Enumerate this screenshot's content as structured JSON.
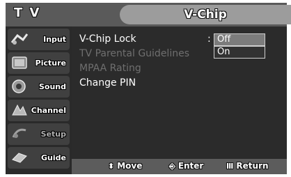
{
  "header": {
    "source_label": "T V",
    "title": "V-Chip"
  },
  "sidebar": {
    "items": [
      {
        "label": "Input",
        "icon": "input-icon"
      },
      {
        "label": "Picture",
        "icon": "picture-icon"
      },
      {
        "label": "Sound",
        "icon": "sound-icon"
      },
      {
        "label": "Channel",
        "icon": "channel-icon"
      },
      {
        "label": "Setup",
        "icon": "setup-icon"
      },
      {
        "label": "Guide",
        "icon": "guide-icon"
      }
    ]
  },
  "menu": {
    "items": [
      {
        "label": "V-Chip Lock",
        "enabled": true
      },
      {
        "label": "TV Parental Guidelines",
        "enabled": false
      },
      {
        "label": "MPAA Rating",
        "enabled": false
      },
      {
        "label": "Change PIN",
        "enabled": true
      }
    ],
    "separator": ":",
    "options": [
      {
        "label": "Off",
        "selected": true
      },
      {
        "label": "On",
        "selected": false
      }
    ]
  },
  "footer": {
    "move": {
      "icon": "⬍",
      "label": "Move"
    },
    "enter": {
      "icon": "⎆",
      "label": "Enter"
    },
    "return": {
      "icon": "Ⅲ",
      "label": "Return"
    }
  },
  "colors": {
    "panel": "#2b2b2b",
    "sidebar": "#2a2a2a",
    "bar": "#5c5c5c",
    "highlight": "#7c7c7c",
    "dim_text": "#6f6f6f"
  }
}
